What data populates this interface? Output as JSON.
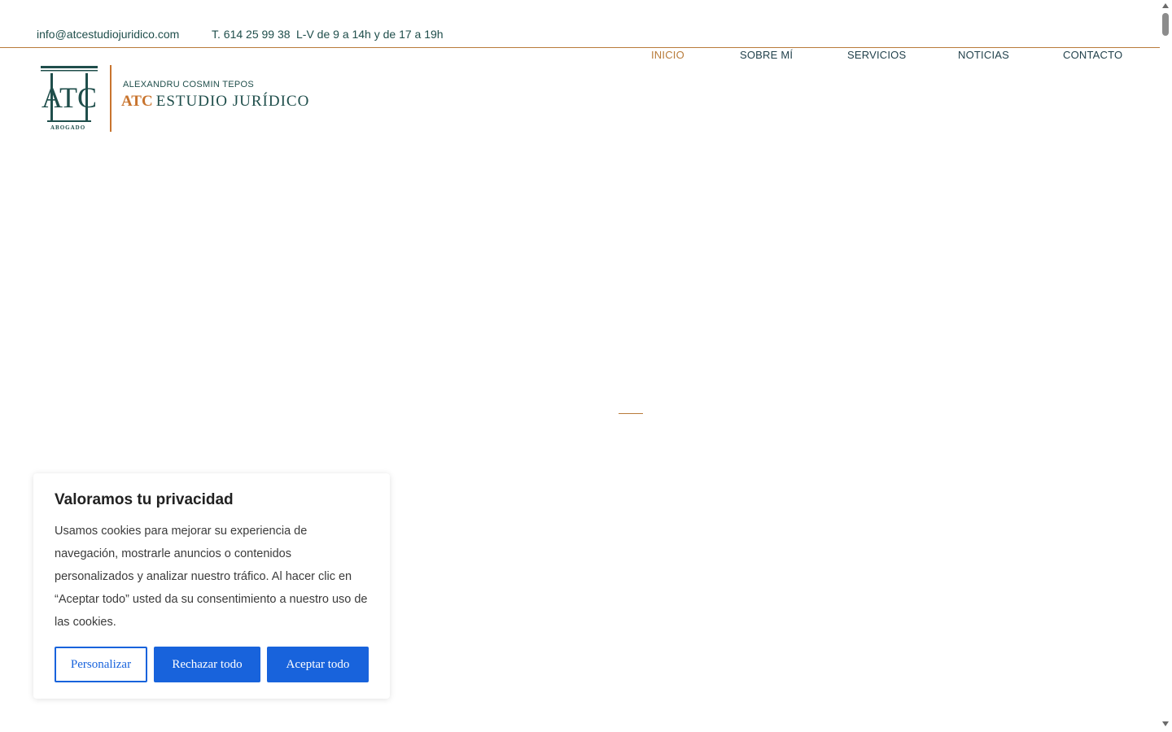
{
  "topbar": {
    "email": "info@atcestudiojuridico.com",
    "phone": "T. 614 25 99 38",
    "hours": "L-V de 9 a 14h y de 17 a 19h"
  },
  "nav": {
    "items": [
      {
        "label": "INICIO",
        "active": true
      },
      {
        "label": "SOBRE MÍ",
        "active": false
      },
      {
        "label": "SERVICIOS",
        "active": false
      },
      {
        "label": "NOTICIAS",
        "active": false
      },
      {
        "label": "CONTACTO",
        "active": false
      }
    ]
  },
  "logo": {
    "mark_text": "ATC",
    "mark_caption": "ABOGADO",
    "name": "ALEXANDRU COSMIN TEPOS",
    "brand_accent": "ATC",
    "brand_text": "ESTUDIO JURÍDICO"
  },
  "cookie": {
    "title": "Valoramos tu privacidad",
    "body": "Usamos cookies para mejorar su experiencia de navegación, mostrarle anuncios o contenidos personalizados y analizar nuestro tráfico. Al hacer clic en “Aceptar todo” usted da su consentimiento a nuestro uso de las cookies.",
    "customize_label": "Personalizar",
    "reject_label": "Rechazar todo",
    "accept_label": "Aceptar todo"
  },
  "colors": {
    "brand_green": "#1f4e4b",
    "accent_orange": "#c8742e",
    "button_blue": "#1863dc"
  }
}
